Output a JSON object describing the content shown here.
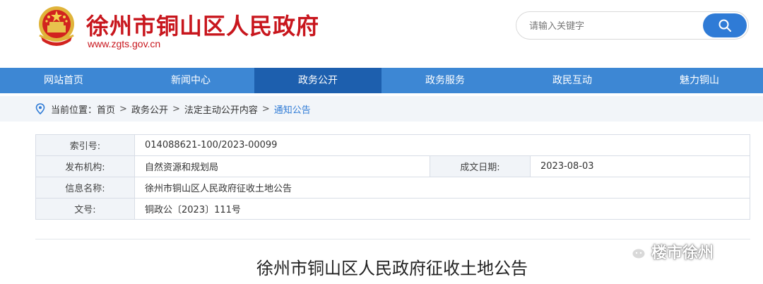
{
  "header": {
    "site_title": "徐州市铜山区人民政府",
    "site_url": "www.zgts.gov.cn",
    "emblem_icon": "national-emblem-icon",
    "search": {
      "placeholder": "请输入关键字",
      "button_icon": "search-icon"
    }
  },
  "nav": {
    "items": [
      {
        "label": "网站首页"
      },
      {
        "label": "新闻中心"
      },
      {
        "label": "政务公开",
        "active": true
      },
      {
        "label": "政务服务"
      },
      {
        "label": "政民互动"
      },
      {
        "label": "魅力铜山"
      }
    ]
  },
  "breadcrumb": {
    "prefix": "当前位置：",
    "items": [
      "首页",
      "政务公开",
      "法定主动公开内容",
      "通知公告"
    ],
    "separator": ">"
  },
  "info": {
    "index_label": "索引号:",
    "index_value": "014088621-100/2023-00099",
    "issuer_label": "发布机构:",
    "issuer_value": "自然资源和规划局",
    "date_label": "成文日期:",
    "date_value": "2023-08-03",
    "name_label": "信息名称:",
    "name_value": "徐州市铜山区人民政府征收土地公告",
    "docno_label": "文号:",
    "docno_value": "铜政公〔2023〕111号"
  },
  "document": {
    "title": "徐州市铜山区人民政府征收土地公告"
  },
  "watermark": {
    "text": "楼市徐州",
    "icon": "wechat-icon"
  },
  "colors": {
    "brand_red": "#c8161d",
    "nav_blue": "#3d87d4",
    "nav_active": "#1d5fae",
    "accent_blue": "#2f7bd6"
  }
}
